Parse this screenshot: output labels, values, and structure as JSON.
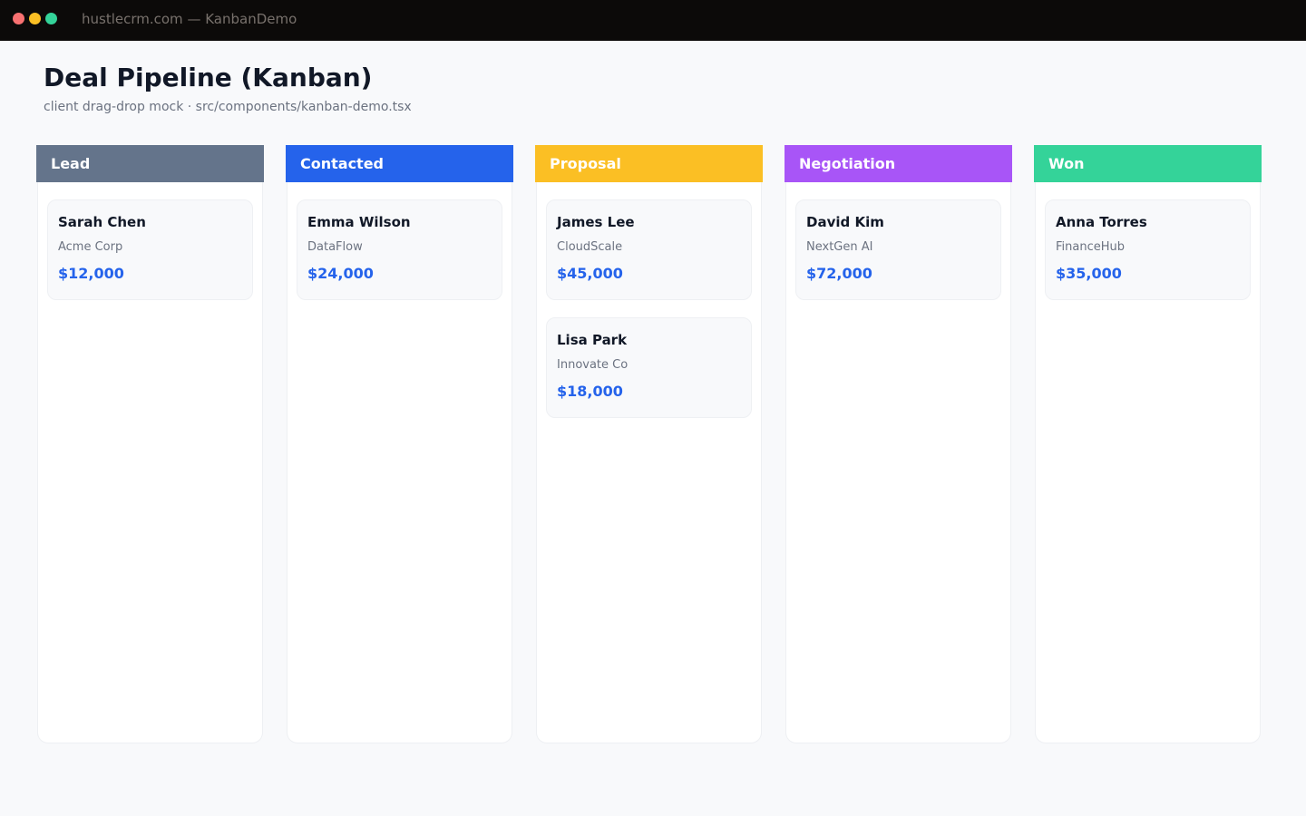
{
  "window": {
    "title": "hustlecrm.com — KanbanDemo",
    "controls": {
      "close_color": "#f87171",
      "minimize_color": "#fbbf24",
      "maximize_color": "#34d399"
    }
  },
  "page": {
    "title": "Deal Pipeline (Kanban)",
    "subtitle": "client drag-drop mock · src/components/kanban-demo.tsx"
  },
  "theme": {
    "value_color": "#2563eb"
  },
  "columns": [
    {
      "label": "Lead",
      "color": "#64748b",
      "cards": [
        {
          "name": "Sarah Chen",
          "company": "Acme Corp",
          "value": "$12,000"
        }
      ]
    },
    {
      "label": "Contacted",
      "color": "#2563eb",
      "cards": [
        {
          "name": "Emma Wilson",
          "company": "DataFlow",
          "value": "$24,000"
        }
      ]
    },
    {
      "label": "Proposal",
      "color": "#fbbf24",
      "cards": [
        {
          "name": "James Lee",
          "company": "CloudScale",
          "value": "$45,000"
        },
        {
          "name": "Lisa Park",
          "company": "Innovate Co",
          "value": "$18,000"
        }
      ]
    },
    {
      "label": "Negotiation",
      "color": "#a855f7",
      "cards": [
        {
          "name": "David Kim",
          "company": "NextGen AI",
          "value": "$72,000"
        }
      ]
    },
    {
      "label": "Won",
      "color": "#34d399",
      "cards": [
        {
          "name": "Anna Torres",
          "company": "FinanceHub",
          "value": "$35,000"
        }
      ]
    }
  ]
}
